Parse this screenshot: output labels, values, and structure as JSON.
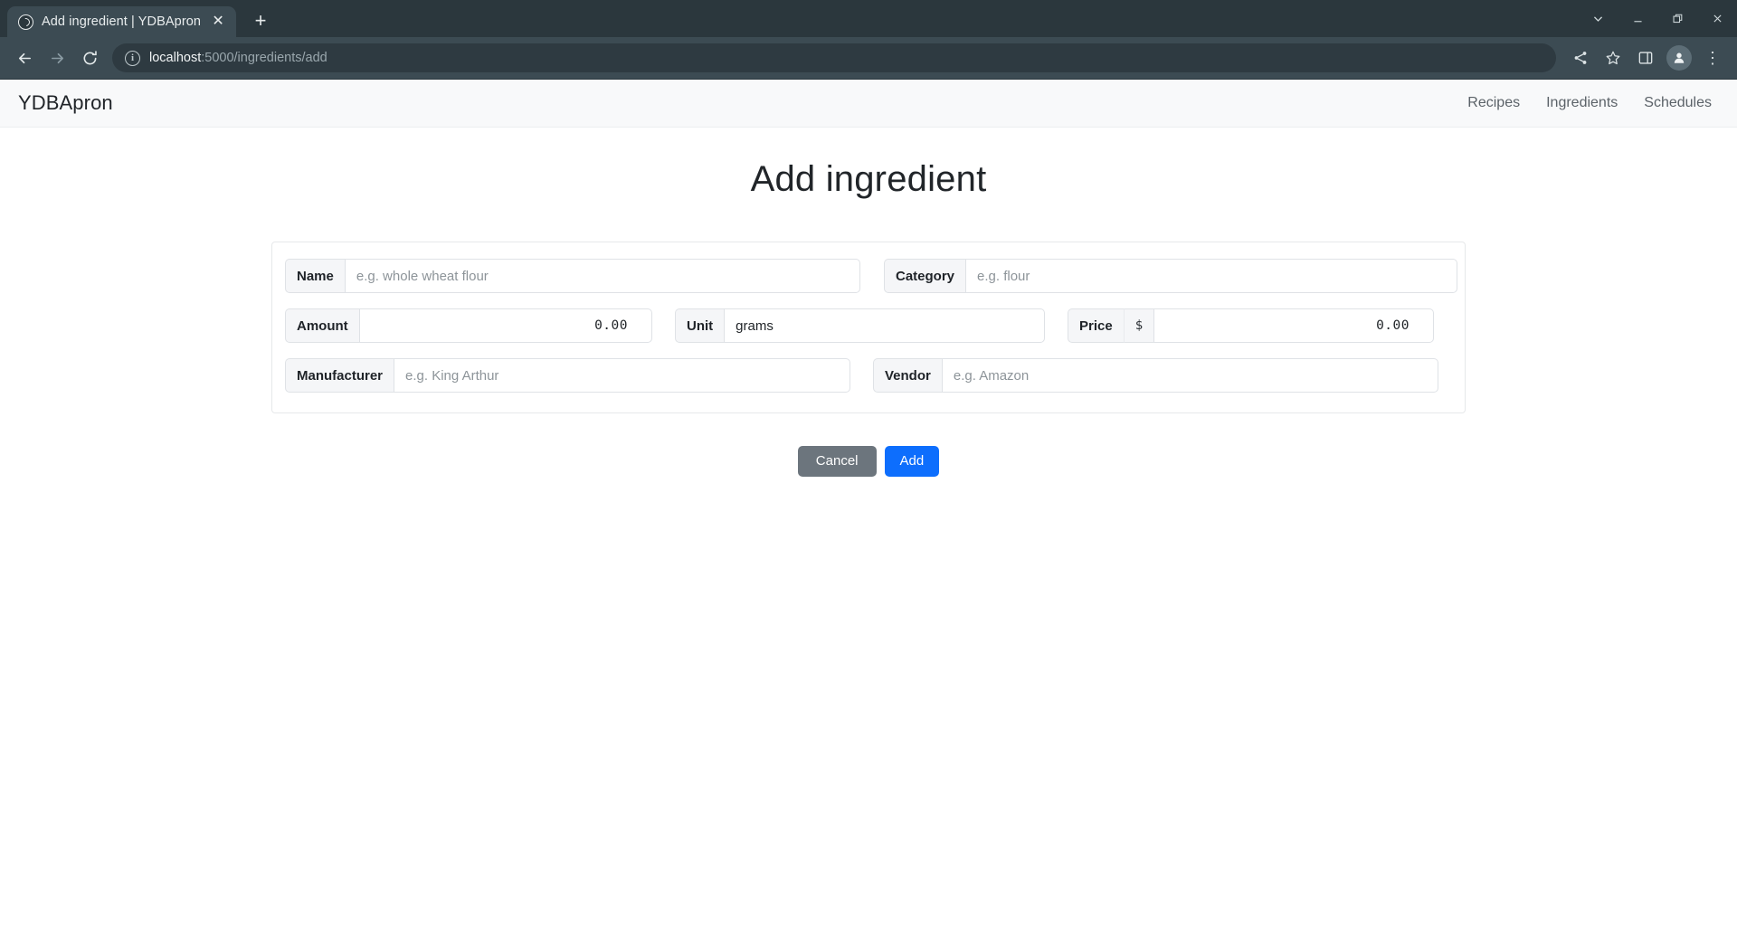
{
  "browser": {
    "tab": {
      "title": "Add ingredient | YDBApron",
      "favicon_name": "globe-favicon",
      "close_label": "✕"
    },
    "new_tab_label": "+",
    "window_controls": [
      {
        "name": "tab-search-chevron-button",
        "label": "∨"
      },
      {
        "name": "minimize-button",
        "label": "–"
      },
      {
        "name": "maximize-button",
        "label": "❐"
      },
      {
        "name": "close-window-button",
        "label": "✕"
      }
    ],
    "toolbar": {
      "back_label": "←",
      "forward_label": "→",
      "reload_label": "⟳",
      "info_label": "i",
      "url_host": "localhost",
      "url_path": ":5000/ingredients/add",
      "share_label": "share-icon",
      "bookmark_label": "star-icon",
      "sidepanel_label": "side-panel-icon",
      "profile_label": "profile-avatar-icon",
      "menu_label": "⋮"
    }
  },
  "navbar": {
    "brand": "YDBApron",
    "links": [
      {
        "label": "Recipes",
        "name": "nav-link-recipes"
      },
      {
        "label": "Ingredients",
        "name": "nav-link-ingredients"
      },
      {
        "label": "Schedules",
        "name": "nav-link-schedules"
      }
    ]
  },
  "page": {
    "title": "Add ingredient"
  },
  "form": {
    "name": {
      "label": "Name",
      "placeholder": "e.g. whole wheat flour",
      "value": ""
    },
    "category": {
      "label": "Category",
      "placeholder": "e.g. flour",
      "value": ""
    },
    "amount": {
      "label": "Amount",
      "placeholder": "",
      "value": "0.00"
    },
    "unit": {
      "label": "Unit",
      "placeholder": "",
      "value": "grams"
    },
    "price": {
      "label": "Price",
      "currency_addon": "$",
      "placeholder": "",
      "value": "0.00"
    },
    "manufacturer": {
      "label": "Manufacturer",
      "placeholder": "e.g. King Arthur",
      "value": ""
    },
    "vendor": {
      "label": "Vendor",
      "placeholder": "e.g. Amazon",
      "value": ""
    }
  },
  "actions": {
    "cancel_label": "Cancel",
    "add_label": "Add"
  },
  "colors": {
    "primary": "#0d6efd",
    "secondary": "#6c757d",
    "navbar_bg": "#f8f9fa",
    "chrome_bg": "#3c4b53",
    "tabstrip_bg": "#2b373d"
  }
}
